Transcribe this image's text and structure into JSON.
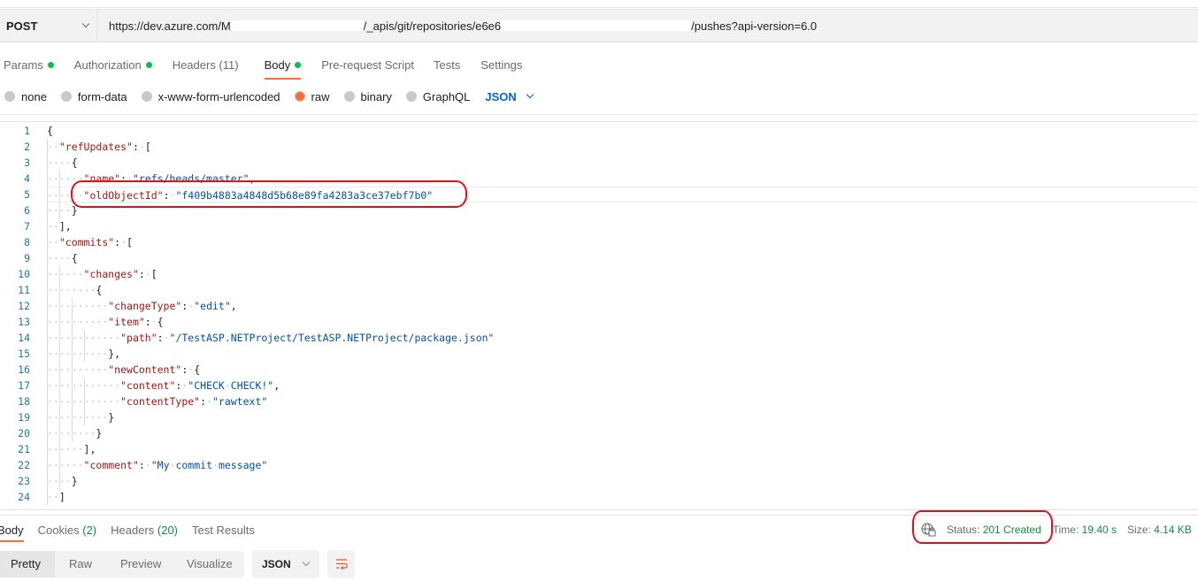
{
  "request": {
    "method": "POST",
    "url_prefix": "https://dev.azure.com/M",
    "url_mid": "/_apis/git/repositories/e6e6",
    "url_suffix": "/pushes?api-version=6.0"
  },
  "request_tabs": [
    {
      "label": "Params",
      "dot": true,
      "active": false
    },
    {
      "label": "Authorization",
      "dot": true,
      "active": false
    },
    {
      "label": "Headers (11)",
      "dot": false,
      "active": false
    },
    {
      "label": "Body",
      "dot": true,
      "active": true
    },
    {
      "label": "Pre-request Script",
      "dot": false,
      "active": false
    },
    {
      "label": "Tests",
      "dot": false,
      "active": false
    },
    {
      "label": "Settings",
      "dot": false,
      "active": false
    }
  ],
  "body_types": [
    {
      "label": "none",
      "checked": false
    },
    {
      "label": "form-data",
      "checked": false
    },
    {
      "label": "x-www-form-urlencoded",
      "checked": false
    },
    {
      "label": "raw",
      "checked": true
    },
    {
      "label": "binary",
      "checked": false
    },
    {
      "label": "GraphQL",
      "checked": false
    }
  ],
  "body_language": "JSON",
  "editor": {
    "current_line": 5,
    "lines": [
      {
        "n": "1",
        "indent": 0,
        "tokens": [
          [
            "p",
            "{"
          ]
        ]
      },
      {
        "n": "2",
        "indent": 1,
        "tokens": [
          [
            "k",
            "\"refUpdates\""
          ],
          [
            "p",
            ":"
          ],
          [
            "w",
            "·"
          ],
          [
            "p",
            "["
          ]
        ]
      },
      {
        "n": "3",
        "indent": 2,
        "tokens": [
          [
            "p",
            "{"
          ]
        ]
      },
      {
        "n": "4",
        "indent": 3,
        "tokens": [
          [
            "k",
            "\"name\""
          ],
          [
            "p",
            ":"
          ],
          [
            "w",
            "·"
          ],
          [
            "s",
            "\"refs/heads/master\""
          ],
          [
            "p",
            ","
          ]
        ]
      },
      {
        "n": "5",
        "indent": 3,
        "tokens": [
          [
            "k",
            "\"oldObjectId\""
          ],
          [
            "p",
            ":"
          ],
          [
            "w",
            "·"
          ],
          [
            "s",
            "\"f409b4883a4848d5b68e89fa4283a3ce37ebf7b0\""
          ]
        ]
      },
      {
        "n": "6",
        "indent": 2,
        "tokens": [
          [
            "p",
            "}"
          ]
        ]
      },
      {
        "n": "7",
        "indent": 1,
        "tokens": [
          [
            "p",
            "],"
          ]
        ]
      },
      {
        "n": "8",
        "indent": 1,
        "tokens": [
          [
            "k",
            "\"commits\""
          ],
          [
            "p",
            ":"
          ],
          [
            "w",
            "·"
          ],
          [
            "p",
            "["
          ]
        ]
      },
      {
        "n": "9",
        "indent": 2,
        "tokens": [
          [
            "p",
            "{"
          ]
        ]
      },
      {
        "n": "10",
        "indent": 3,
        "tokens": [
          [
            "k",
            "\"changes\""
          ],
          [
            "p",
            ":"
          ],
          [
            "w",
            "·"
          ],
          [
            "p",
            "["
          ]
        ]
      },
      {
        "n": "11",
        "indent": 4,
        "tokens": [
          [
            "p",
            "{"
          ]
        ]
      },
      {
        "n": "12",
        "indent": 5,
        "tokens": [
          [
            "k",
            "\"changeType\""
          ],
          [
            "p",
            ":"
          ],
          [
            "w",
            "·"
          ],
          [
            "s",
            "\"edit\""
          ],
          [
            "p",
            ","
          ]
        ]
      },
      {
        "n": "13",
        "indent": 5,
        "tokens": [
          [
            "k",
            "\"item\""
          ],
          [
            "p",
            ":"
          ],
          [
            "w",
            "·"
          ],
          [
            "p",
            "{"
          ]
        ]
      },
      {
        "n": "14",
        "indent": 6,
        "tokens": [
          [
            "k",
            "\"path\""
          ],
          [
            "p",
            ":"
          ],
          [
            "w",
            "·"
          ],
          [
            "s",
            "\"/TestASP.NETProject/TestASP.NETProject/package.json\""
          ]
        ]
      },
      {
        "n": "15",
        "indent": 5,
        "tokens": [
          [
            "p",
            "},"
          ]
        ]
      },
      {
        "n": "16",
        "indent": 5,
        "tokens": [
          [
            "k",
            "\"newContent\""
          ],
          [
            "p",
            ":"
          ],
          [
            "w",
            "·"
          ],
          [
            "p",
            "{"
          ]
        ]
      },
      {
        "n": "17",
        "indent": 6,
        "tokens": [
          [
            "k",
            "\"content\""
          ],
          [
            "p",
            ":"
          ],
          [
            "w",
            "·"
          ],
          [
            "s",
            "\"CHECK·CHECK!\""
          ],
          [
            "p",
            ","
          ]
        ]
      },
      {
        "n": "18",
        "indent": 6,
        "tokens": [
          [
            "k",
            "\"contentType\""
          ],
          [
            "p",
            ":"
          ],
          [
            "w",
            "·"
          ],
          [
            "s",
            "\"rawtext\""
          ]
        ]
      },
      {
        "n": "19",
        "indent": 5,
        "tokens": [
          [
            "p",
            "}"
          ]
        ]
      },
      {
        "n": "20",
        "indent": 4,
        "tokens": [
          [
            "p",
            "}"
          ]
        ]
      },
      {
        "n": "21",
        "indent": 3,
        "tokens": [
          [
            "p",
            "],"
          ]
        ]
      },
      {
        "n": "22",
        "indent": 3,
        "tokens": [
          [
            "k",
            "\"comment\""
          ],
          [
            "p",
            ":"
          ],
          [
            "w",
            "·"
          ],
          [
            "s",
            "\"My·commit·message\""
          ]
        ]
      },
      {
        "n": "23",
        "indent": 2,
        "tokens": [
          [
            "p",
            "}"
          ]
        ]
      },
      {
        "n": "24",
        "indent": 1,
        "tokens": [
          [
            "p",
            "]"
          ]
        ]
      }
    ]
  },
  "response_tabs": [
    {
      "label": "Body",
      "count": "",
      "active": true
    },
    {
      "label": "Cookies",
      "count": "(2)",
      "active": false
    },
    {
      "label": "Headers",
      "count": "(20)",
      "active": false
    },
    {
      "label": "Test Results",
      "count": "",
      "active": false
    }
  ],
  "response_meta": {
    "status_label": "Status:",
    "status_value": "201 Created",
    "time_label": "Time:",
    "time_value": "19.40 s",
    "size_label": "Size:",
    "size_value": "4.14 KB"
  },
  "view_modes": [
    {
      "label": "Pretty",
      "active": true
    },
    {
      "label": "Raw",
      "active": false
    },
    {
      "label": "Preview",
      "active": false
    },
    {
      "label": "Visualize",
      "active": false
    }
  ],
  "response_format": "JSON",
  "colors": {
    "accent": "#ff6c37",
    "status_green": "#0f8e43",
    "dot_green": "#0cbb52",
    "link_blue": "#0265d2",
    "annotation_red": "#e0101a"
  }
}
